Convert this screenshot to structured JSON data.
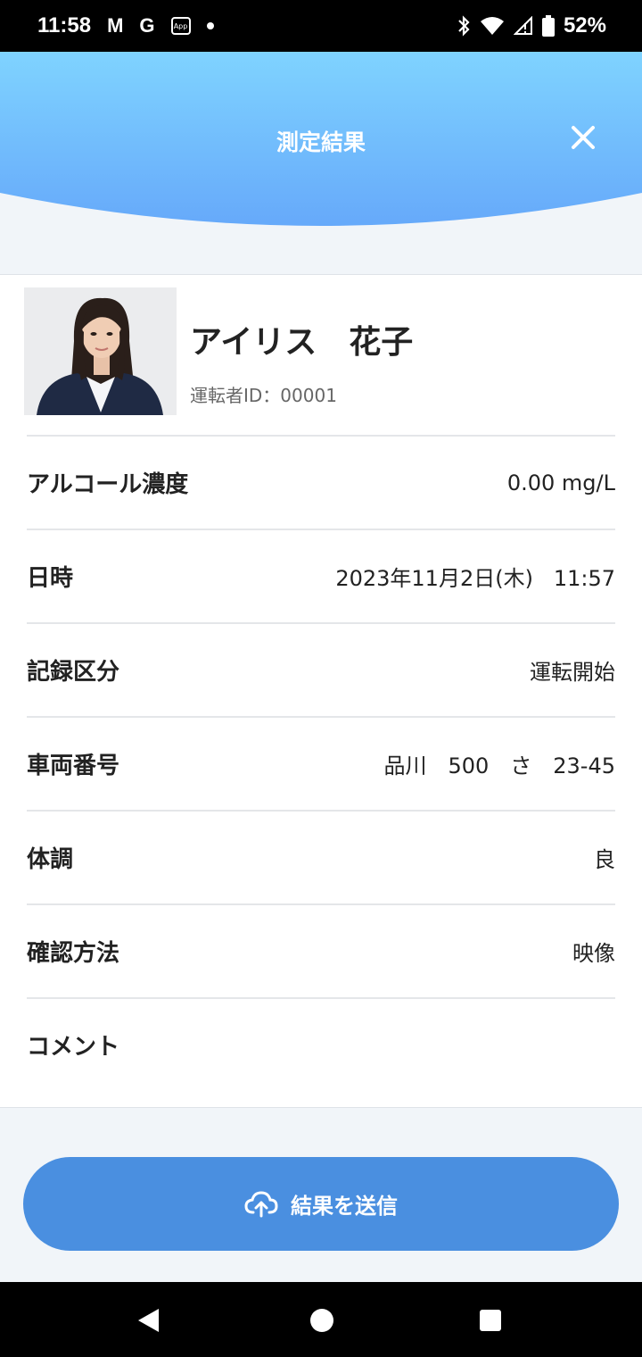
{
  "status_bar": {
    "time": "11:58",
    "icons": [
      "gmail-icon",
      "google-icon",
      "app-icon",
      "dot-icon",
      "bluetooth-icon",
      "wifi-icon",
      "signal-icon",
      "battery-icon"
    ],
    "mail_glyph": "M",
    "google_glyph": "G",
    "app_glyph": "App",
    "battery": "52%"
  },
  "header": {
    "title": "測定結果",
    "gradient_top": "#7fd3ff",
    "gradient_bottom": "#66a9fa"
  },
  "profile": {
    "name": "アイリス　花子",
    "driver_id": "運転者ID：00001"
  },
  "rows": [
    {
      "label": "アルコール濃度",
      "value": "0.00 mg/L"
    },
    {
      "label": "日時",
      "value": "2023年11月2日(木)   11:57"
    },
    {
      "label": "記録区分",
      "value": "運転開始"
    },
    {
      "label": "車両番号",
      "value": "品川　500　さ　23-45"
    },
    {
      "label": "体調",
      "value": "良"
    },
    {
      "label": "確認方法",
      "value": "映像"
    },
    {
      "label": "コメント",
      "value": ""
    }
  ],
  "send_button": {
    "label": "結果を送信",
    "color": "#4a8fe0"
  }
}
